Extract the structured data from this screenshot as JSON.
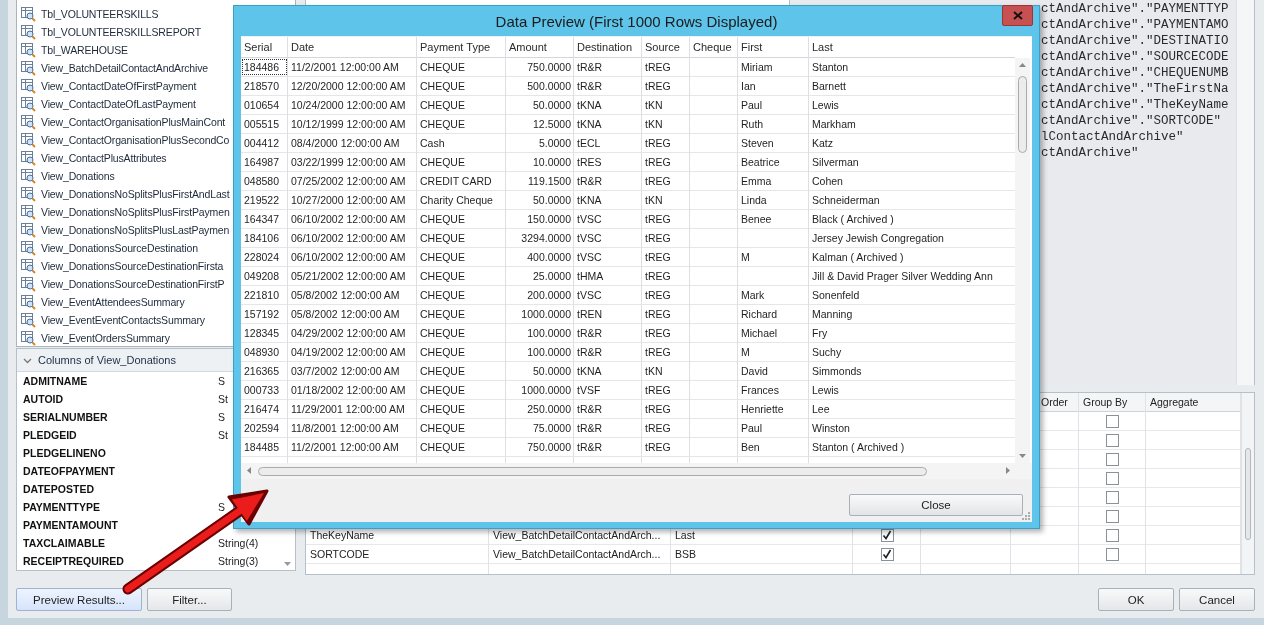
{
  "object_tree": {
    "items": [
      "Tbl_VOLUNTEERSKILLS",
      "Tbl_VOLUNTEERSKILLSREPORT",
      "Tbl_WAREHOUSE",
      "View_BatchDetailContactAndArchive",
      "View_ContactDateOfFirstPayment",
      "View_ContactDateOfLastPayment",
      "View_ContactOrganisationPlusMainCont",
      "View_ContactOrganisationPlusSecondCo",
      "View_ContactPlusAttributes",
      "View_Donations",
      "View_DonationsNoSplitsPlusFirstAndLast",
      "View_DonationsNoSplitsPlusFirstPaymen",
      "View_DonationsNoSplitsPlusLastPaymen",
      "View_DonationsSourceDestination",
      "View_DonationsSourceDestinationFirsta",
      "View_DonationsSourceDestinationFirstP",
      "View_EventAttendeesSummary",
      "View_EventEventContactsSummary",
      "View_EventOrdersSummary"
    ]
  },
  "columns_panel": {
    "title": "Columns of View_Donations",
    "expanded": true,
    "rows": [
      {
        "name": "ADMITNAME",
        "type": "S"
      },
      {
        "name": "AUTOID",
        "type": "St"
      },
      {
        "name": "SERIALNUMBER",
        "type": "S"
      },
      {
        "name": "PLEDGEID",
        "type": "St"
      },
      {
        "name": "PLEDGELINENO"
      },
      {
        "name": "DATEOFPAYMENT"
      },
      {
        "name": "DATEPOSTED"
      },
      {
        "name": "PAYMENTTYPE",
        "type": "S"
      },
      {
        "name": "PAYMENTAMOUNT"
      },
      {
        "name": "TAXCLAIMABLE",
        "type": "String(4)"
      },
      {
        "name": "RECEIPTREQUIRED",
        "type": "String(3)"
      }
    ]
  },
  "left_buttons": [
    {
      "label": "Preview Results...",
      "default": true
    },
    {
      "label": "Filter...",
      "default": false
    }
  ],
  "query_text": {
    "lines": [
      "ctAndArchive\".\"PAYMENTTYP",
      "ctAndArchive\".\"PAYMENTAMO",
      "ctAndArchive\".\"DESTINATIO",
      "ctAndArchive\".\"SOURCECODE",
      "ctAndArchive\".\"CHEQUENUMB",
      "ctAndArchive\".\"TheFirstNa",
      "ctAndArchive\".\"TheKeyName",
      "ctAndArchive\".\"SORTCODE\"",
      "lContactAndArchive\"",
      "ctAndArchive\""
    ]
  },
  "field_grid": {
    "headers": {
      "order": "Order",
      "group_by": "Group By",
      "aggregate": "Aggregate"
    },
    "rows": [
      {
        "group_by": false
      },
      {
        "group_by": false
      },
      {
        "group_by": false
      },
      {
        "group_by": false
      },
      {
        "group_by": false
      },
      {
        "group_by": false
      },
      {
        "column_1": "TheKeyName",
        "column_2": "View_BatchDetailContactAndArch...",
        "column_3": "Last",
        "output": true,
        "group_by": false
      },
      {
        "column_1": "SORTCODE",
        "column_2": "View_BatchDetailContactAndArch...",
        "column_3": "BSB",
        "output": true,
        "group_by": false
      }
    ]
  },
  "dialog_buttons": [
    {
      "label": "OK"
    },
    {
      "label": "Cancel"
    }
  ],
  "preview_dialog": {
    "title": "Data Preview (First 1000 Rows Displayed)",
    "columns": [
      "Serial",
      "Date",
      "Payment Type",
      "Amount",
      "Destination",
      "Source",
      "Cheque",
      "First",
      "Last"
    ],
    "close_button": "Close",
    "rows": [
      {
        "serial": "184486",
        "date": "11/2/2001 12:00:00 AM",
        "payment_type": "CHEQUE",
        "amount": "750.0000",
        "destination": "tR&R",
        "source": "tREG",
        "first": "Miriam",
        "last": "Stanton",
        "focused": true
      },
      {
        "serial": "218570",
        "date": "12/20/2000 12:00:00 AM",
        "payment_type": "CHEQUE",
        "amount": "500.0000",
        "destination": "tR&R",
        "source": "tREG",
        "first": "Ian",
        "last": "Barnett",
        "focused": false
      },
      {
        "serial": "010654",
        "date": "10/24/2000 12:00:00 AM",
        "payment_type": "CHEQUE",
        "amount": "50.0000",
        "destination": "tKNA",
        "source": "tKN",
        "first": "Paul",
        "last": "Lewis",
        "focused": false
      },
      {
        "serial": "005515",
        "date": "10/12/1999 12:00:00 AM",
        "payment_type": "CHEQUE",
        "amount": "12.5000",
        "destination": "tKNA",
        "source": "tKN",
        "first": "Ruth",
        "last": "Markham",
        "focused": false
      },
      {
        "serial": "004412",
        "date": "08/4/2000 12:00:00 AM",
        "payment_type": "Cash",
        "amount": "5.0000",
        "destination": "tECL",
        "source": "tREG",
        "first": "Steven",
        "last": "Katz",
        "focused": false
      },
      {
        "serial": "164987",
        "date": "03/22/1999 12:00:00 AM",
        "payment_type": "CHEQUE",
        "amount": "10.0000",
        "destination": "tRES",
        "source": "tREG",
        "first": "Beatrice",
        "last": "Silverman",
        "focused": false
      },
      {
        "serial": "048580",
        "date": "07/25/2002 12:00:00 AM",
        "payment_type": "CREDIT CARD",
        "amount": "119.1500",
        "destination": "tR&R",
        "source": "tREG",
        "first": "Emma",
        "last": "Cohen",
        "focused": false
      },
      {
        "serial": "219522",
        "date": "10/27/2000 12:00:00 AM",
        "payment_type": "Charity Cheque",
        "amount": "50.0000",
        "destination": "tKNA",
        "source": "tKN",
        "first": "Linda",
        "last": "Schneiderman",
        "focused": false
      },
      {
        "serial": "164347",
        "date": "06/10/2002 12:00:00 AM",
        "payment_type": "CHEQUE",
        "amount": "150.0000",
        "destination": "tVSC",
        "source": "tREG",
        "first": "Benee",
        "last": "Black ( Archived )",
        "focused": false
      },
      {
        "serial": "184106",
        "date": "06/10/2002 12:00:00 AM",
        "payment_type": "CHEQUE",
        "amount": "3294.0000",
        "destination": "tVSC",
        "source": "tREG",
        "last": "Jersey Jewish Congregation",
        "focused": false
      },
      {
        "serial": "228024",
        "date": "06/10/2002 12:00:00 AM",
        "payment_type": "CHEQUE",
        "amount": "400.0000",
        "destination": "tVSC",
        "source": "tREG",
        "first": "M",
        "last": "Kalman ( Archived )",
        "focused": false
      },
      {
        "serial": "049208",
        "date": "05/21/2002 12:00:00 AM",
        "payment_type": "CHEQUE",
        "amount": "25.0000",
        "destination": "tHMA",
        "source": "tREG",
        "last": "Jill & David Prager Silver Wedding Ann",
        "focused": false
      },
      {
        "serial": "221810",
        "date": "05/8/2002 12:00:00 AM",
        "payment_type": "CHEQUE",
        "amount": "200.0000",
        "destination": "tVSC",
        "source": "tREG",
        "first": "Mark",
        "last": "Sonenfeld",
        "focused": false
      },
      {
        "serial": "157192",
        "date": "05/8/2002 12:00:00 AM",
        "payment_type": "CHEQUE",
        "amount": "1000.0000",
        "destination": "tREN",
        "source": "tREG",
        "first": "Richard",
        "last": "Manning",
        "focused": false
      },
      {
        "serial": "128345",
        "date": "04/29/2002 12:00:00 AM",
        "payment_type": "CHEQUE",
        "amount": "100.0000",
        "destination": "tR&R",
        "source": "tREG",
        "first": "Michael",
        "last": "Fry",
        "focused": false
      },
      {
        "serial": "048930",
        "date": "04/19/2002 12:00:00 AM",
        "payment_type": "CHEQUE",
        "amount": "100.0000",
        "destination": "tR&R",
        "source": "tREG",
        "first": "M",
        "last": "Suchy",
        "focused": false
      },
      {
        "serial": "216365",
        "date": "03/7/2002 12:00:00 AM",
        "payment_type": "CHEQUE",
        "amount": "50.0000",
        "destination": "tKNA",
        "source": "tKN",
        "first": "David",
        "last": "Simmonds",
        "focused": false
      },
      {
        "serial": "000733",
        "date": "01/18/2002 12:00:00 AM",
        "payment_type": "CHEQUE",
        "amount": "1000.0000",
        "destination": "tVSF",
        "source": "tREG",
        "first": "Frances",
        "last": "Lewis",
        "focused": false
      },
      {
        "serial": "216474",
        "date": "11/29/2001 12:00:00 AM",
        "payment_type": "CHEQUE",
        "amount": "250.0000",
        "destination": "tR&R",
        "source": "tREG",
        "first": "Henriette",
        "last": "Lee",
        "focused": false
      },
      {
        "serial": "202594",
        "date": "11/8/2001 12:00:00 AM",
        "payment_type": "CHEQUE",
        "amount": "75.0000",
        "destination": "tR&R",
        "source": "tREG",
        "first": "Paul",
        "last": "Winston",
        "focused": false
      },
      {
        "serial": "184485",
        "date": "11/2/2001 12:00:00 AM",
        "payment_type": "CHEQUE",
        "amount": "750.0000",
        "destination": "tR&R",
        "source": "tREG",
        "first": "Ben",
        "last": "Stanton ( Archived )",
        "focused": false
      }
    ]
  }
}
